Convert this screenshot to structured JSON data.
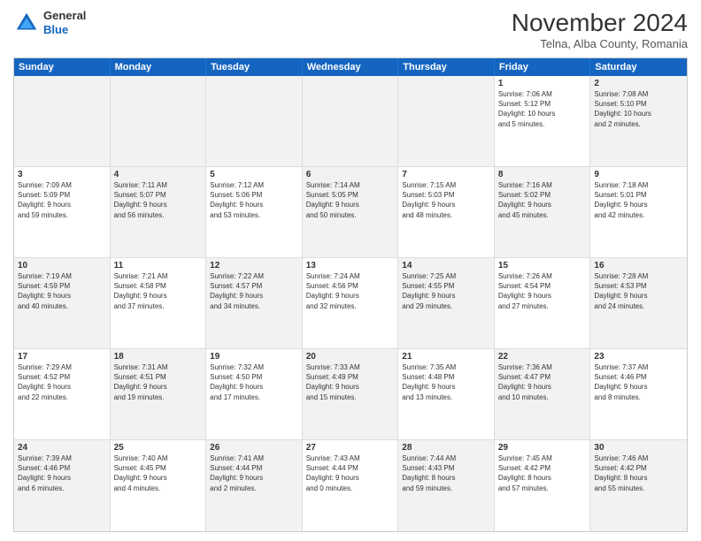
{
  "header": {
    "logo_general": "General",
    "logo_blue": "Blue",
    "month": "November 2024",
    "location": "Telna, Alba County, Romania"
  },
  "weekdays": [
    "Sunday",
    "Monday",
    "Tuesday",
    "Wednesday",
    "Thursday",
    "Friday",
    "Saturday"
  ],
  "rows": [
    [
      {
        "day": "",
        "info": "",
        "shaded": true
      },
      {
        "day": "",
        "info": "",
        "shaded": true
      },
      {
        "day": "",
        "info": "",
        "shaded": true
      },
      {
        "day": "",
        "info": "",
        "shaded": true
      },
      {
        "day": "",
        "info": "",
        "shaded": true
      },
      {
        "day": "1",
        "info": "Sunrise: 7:06 AM\nSunset: 5:12 PM\nDaylight: 10 hours\nand 5 minutes.",
        "shaded": false
      },
      {
        "day": "2",
        "info": "Sunrise: 7:08 AM\nSunset: 5:10 PM\nDaylight: 10 hours\nand 2 minutes.",
        "shaded": true
      }
    ],
    [
      {
        "day": "3",
        "info": "Sunrise: 7:09 AM\nSunset: 5:09 PM\nDaylight: 9 hours\nand 59 minutes.",
        "shaded": false
      },
      {
        "day": "4",
        "info": "Sunrise: 7:11 AM\nSunset: 5:07 PM\nDaylight: 9 hours\nand 56 minutes.",
        "shaded": true
      },
      {
        "day": "5",
        "info": "Sunrise: 7:12 AM\nSunset: 5:06 PM\nDaylight: 9 hours\nand 53 minutes.",
        "shaded": false
      },
      {
        "day": "6",
        "info": "Sunrise: 7:14 AM\nSunset: 5:05 PM\nDaylight: 9 hours\nand 50 minutes.",
        "shaded": true
      },
      {
        "day": "7",
        "info": "Sunrise: 7:15 AM\nSunset: 5:03 PM\nDaylight: 9 hours\nand 48 minutes.",
        "shaded": false
      },
      {
        "day": "8",
        "info": "Sunrise: 7:16 AM\nSunset: 5:02 PM\nDaylight: 9 hours\nand 45 minutes.",
        "shaded": true
      },
      {
        "day": "9",
        "info": "Sunrise: 7:18 AM\nSunset: 5:01 PM\nDaylight: 9 hours\nand 42 minutes.",
        "shaded": false
      }
    ],
    [
      {
        "day": "10",
        "info": "Sunrise: 7:19 AM\nSunset: 4:59 PM\nDaylight: 9 hours\nand 40 minutes.",
        "shaded": true
      },
      {
        "day": "11",
        "info": "Sunrise: 7:21 AM\nSunset: 4:58 PM\nDaylight: 9 hours\nand 37 minutes.",
        "shaded": false
      },
      {
        "day": "12",
        "info": "Sunrise: 7:22 AM\nSunset: 4:57 PM\nDaylight: 9 hours\nand 34 minutes.",
        "shaded": true
      },
      {
        "day": "13",
        "info": "Sunrise: 7:24 AM\nSunset: 4:56 PM\nDaylight: 9 hours\nand 32 minutes.",
        "shaded": false
      },
      {
        "day": "14",
        "info": "Sunrise: 7:25 AM\nSunset: 4:55 PM\nDaylight: 9 hours\nand 29 minutes.",
        "shaded": true
      },
      {
        "day": "15",
        "info": "Sunrise: 7:26 AM\nSunset: 4:54 PM\nDaylight: 9 hours\nand 27 minutes.",
        "shaded": false
      },
      {
        "day": "16",
        "info": "Sunrise: 7:28 AM\nSunset: 4:53 PM\nDaylight: 9 hours\nand 24 minutes.",
        "shaded": true
      }
    ],
    [
      {
        "day": "17",
        "info": "Sunrise: 7:29 AM\nSunset: 4:52 PM\nDaylight: 9 hours\nand 22 minutes.",
        "shaded": false
      },
      {
        "day": "18",
        "info": "Sunrise: 7:31 AM\nSunset: 4:51 PM\nDaylight: 9 hours\nand 19 minutes.",
        "shaded": true
      },
      {
        "day": "19",
        "info": "Sunrise: 7:32 AM\nSunset: 4:50 PM\nDaylight: 9 hours\nand 17 minutes.",
        "shaded": false
      },
      {
        "day": "20",
        "info": "Sunrise: 7:33 AM\nSunset: 4:49 PM\nDaylight: 9 hours\nand 15 minutes.",
        "shaded": true
      },
      {
        "day": "21",
        "info": "Sunrise: 7:35 AM\nSunset: 4:48 PM\nDaylight: 9 hours\nand 13 minutes.",
        "shaded": false
      },
      {
        "day": "22",
        "info": "Sunrise: 7:36 AM\nSunset: 4:47 PM\nDaylight: 9 hours\nand 10 minutes.",
        "shaded": true
      },
      {
        "day": "23",
        "info": "Sunrise: 7:37 AM\nSunset: 4:46 PM\nDaylight: 9 hours\nand 8 minutes.",
        "shaded": false
      }
    ],
    [
      {
        "day": "24",
        "info": "Sunrise: 7:39 AM\nSunset: 4:46 PM\nDaylight: 9 hours\nand 6 minutes.",
        "shaded": true
      },
      {
        "day": "25",
        "info": "Sunrise: 7:40 AM\nSunset: 4:45 PM\nDaylight: 9 hours\nand 4 minutes.",
        "shaded": false
      },
      {
        "day": "26",
        "info": "Sunrise: 7:41 AM\nSunset: 4:44 PM\nDaylight: 9 hours\nand 2 minutes.",
        "shaded": true
      },
      {
        "day": "27",
        "info": "Sunrise: 7:43 AM\nSunset: 4:44 PM\nDaylight: 9 hours\nand 0 minutes.",
        "shaded": false
      },
      {
        "day": "28",
        "info": "Sunrise: 7:44 AM\nSunset: 4:43 PM\nDaylight: 8 hours\nand 59 minutes.",
        "shaded": true
      },
      {
        "day": "29",
        "info": "Sunrise: 7:45 AM\nSunset: 4:42 PM\nDaylight: 8 hours\nand 57 minutes.",
        "shaded": false
      },
      {
        "day": "30",
        "info": "Sunrise: 7:46 AM\nSunset: 4:42 PM\nDaylight: 8 hours\nand 55 minutes.",
        "shaded": true
      }
    ]
  ]
}
